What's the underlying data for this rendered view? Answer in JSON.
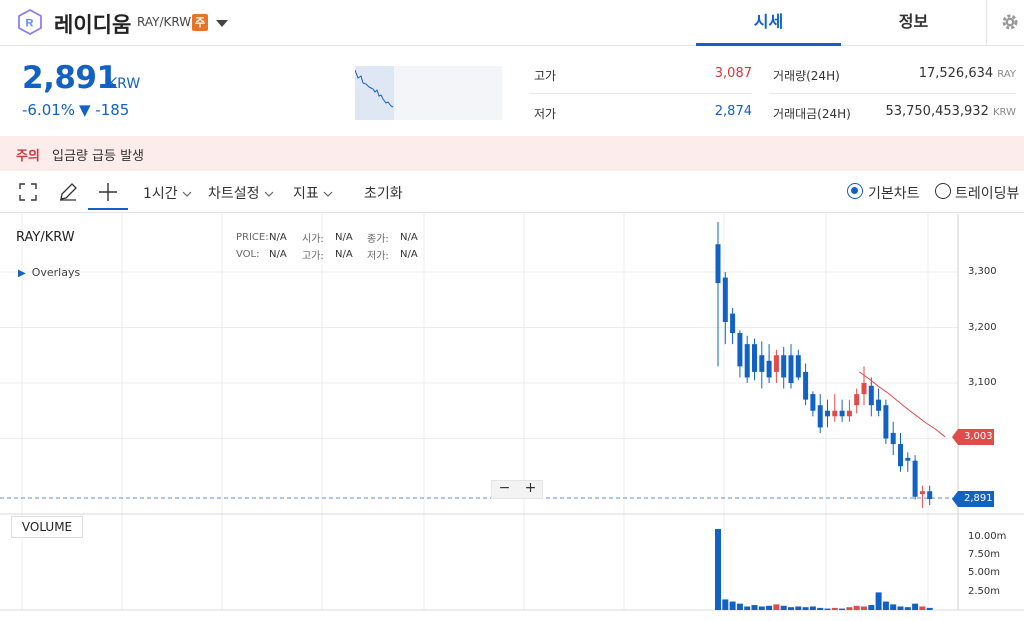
{
  "header": {
    "coin_name": "레이디움",
    "pair": "RAY/KRW",
    "warning_badge": "주",
    "tabs": [
      {
        "label": "시세"
      },
      {
        "label": "정보"
      }
    ]
  },
  "price": {
    "current": "2,891",
    "unit": "KRW",
    "change_rate": "-6.01%",
    "change_amount": "▼ -185"
  },
  "stats": {
    "high_label": "고가",
    "high_value": "3,087",
    "low_label": "저가",
    "low_value": "2,874",
    "volume_label": "거래량(24H)",
    "volume_value": "17,526,634",
    "volume_unit": "RAY",
    "amount_label": "거래대금(24H)",
    "amount_value": "53,750,453,932",
    "amount_unit": "KRW"
  },
  "notice": {
    "tag": "주의",
    "text": "입금량 급등 발생"
  },
  "toolbar": {
    "interval": "1시간",
    "chart_settings": "차트설정",
    "indicators": "지표",
    "reset": "초기화",
    "basic_chart": "기본차트",
    "trading_view": "트레이딩뷰"
  },
  "chart_info": {
    "pair": "RAY/KRW",
    "overlays": "Overlays",
    "price_k": "PRICE:",
    "price_v": "N/A",
    "open_k": "시가:",
    "open_v": "N/A",
    "close_k": "종가:",
    "close_v": "N/A",
    "vol_k": "VOL:",
    "vol_v": "N/A",
    "high_k": "고가:",
    "high_v": "N/A",
    "low_k": "저가:",
    "low_v": "N/A",
    "volume_pane_label": "VOLUME",
    "zoom_minus": "−",
    "zoom_plus": "+",
    "ma_value": "3,003",
    "current_value": "2,891"
  },
  "colors": {
    "accent": "#1261c4",
    "up": "#e04b4b",
    "down": "#1261c4"
  },
  "chart_data": {
    "type": "candlestick",
    "y_ticks": [
      "3,300",
      "3,200",
      "3,100"
    ],
    "volume_ticks": [
      "10.00m",
      "7.50m",
      "5.00m",
      "2.50m"
    ],
    "ylim": [
      2860,
      3410
    ],
    "volume_ylim": [
      0,
      12.5
    ],
    "candles": [
      {
        "o": 3350,
        "h": 3390,
        "l": 3130,
        "c": 3280,
        "v": 11.5
      },
      {
        "o": 3290,
        "h": 3300,
        "l": 3170,
        "c": 3210,
        "v": 1.5
      },
      {
        "o": 3225,
        "h": 3235,
        "l": 3170,
        "c": 3190,
        "v": 1.2
      },
      {
        "o": 3190,
        "h": 3195,
        "l": 3110,
        "c": 3130,
        "v": 0.9
      },
      {
        "o": 3170,
        "h": 3185,
        "l": 3100,
        "c": 3110,
        "v": 0.5
      },
      {
        "o": 3170,
        "h": 3180,
        "l": 3105,
        "c": 3120,
        "v": 0.7
      },
      {
        "o": 3150,
        "h": 3175,
        "l": 3090,
        "c": 3120,
        "v": 0.5
      },
      {
        "o": 3140,
        "h": 3170,
        "l": 3100,
        "c": 3110,
        "v": 0.6
      },
      {
        "o": 3120,
        "h": 3160,
        "l": 3100,
        "c": 3150,
        "v": 0.8
      },
      {
        "o": 3150,
        "h": 3165,
        "l": 3090,
        "c": 3110,
        "v": 0.6
      },
      {
        "o": 3150,
        "h": 3170,
        "l": 3090,
        "c": 3100,
        "v": 0.4
      },
      {
        "o": 3150,
        "h": 3160,
        "l": 3105,
        "c": 3110,
        "v": 0.5
      },
      {
        "o": 3120,
        "h": 3135,
        "l": 3060,
        "c": 3070,
        "v": 0.4
      },
      {
        "o": 3080,
        "h": 3085,
        "l": 3040,
        "c": 3050,
        "v": 0.5
      },
      {
        "o": 3060,
        "h": 3080,
        "l": 3010,
        "c": 3020,
        "v": 0.3
      },
      {
        "o": 3050,
        "h": 3070,
        "l": 3020,
        "c": 3040,
        "v": 0.2
      },
      {
        "o": 3040,
        "h": 3080,
        "l": 3030,
        "c": 3050,
        "v": 0.3
      },
      {
        "o": 3050,
        "h": 3070,
        "l": 3030,
        "c": 3040,
        "v": 0.2
      },
      {
        "o": 3040,
        "h": 3070,
        "l": 3030,
        "c": 3050,
        "v": 0.4
      },
      {
        "o": 3060,
        "h": 3090,
        "l": 3045,
        "c": 3080,
        "v": 0.6
      },
      {
        "o": 3080,
        "h": 3130,
        "l": 3060,
        "c": 3100,
        "v": 0.5
      },
      {
        "o": 3095,
        "h": 3110,
        "l": 3040,
        "c": 3060,
        "v": 0.7
      },
      {
        "o": 3070,
        "h": 3090,
        "l": 3040,
        "c": 3050,
        "v": 2.5
      },
      {
        "o": 3060,
        "h": 3070,
        "l": 2990,
        "c": 3000,
        "v": 1.2
      },
      {
        "o": 3010,
        "h": 3030,
        "l": 2970,
        "c": 2990,
        "v": 0.8
      },
      {
        "o": 2990,
        "h": 3010,
        "l": 2940,
        "c": 2950,
        "v": 0.5
      },
      {
        "o": 2965,
        "h": 2975,
        "l": 2940,
        "c": 2960,
        "v": 0.4
      },
      {
        "o": 2960,
        "h": 2970,
        "l": 2890,
        "c": 2895,
        "v": 0.9
      },
      {
        "o": 2900,
        "h": 2915,
        "l": 2875,
        "c": 2905,
        "v": 0.5
      },
      {
        "o": 2905,
        "h": 2915,
        "l": 2880,
        "c": 2891,
        "v": 0.3
      }
    ],
    "ma_line": [
      3120,
      3108,
      3094,
      3082,
      3068,
      3054,
      3041,
      3028,
      3017,
      3003
    ],
    "ma_start_index": 21,
    "ma_start_offset": -12
  }
}
